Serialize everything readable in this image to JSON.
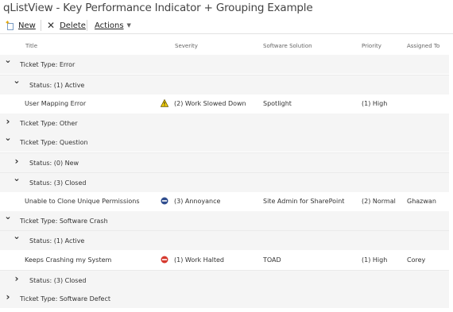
{
  "title": "qListView - Key Performance Indicator + Grouping Example",
  "toolbar": {
    "new_label": "New",
    "delete_label": "Delete",
    "actions_label": "Actions"
  },
  "columns": {
    "title": "Title",
    "severity": "Severity",
    "solution": "Software Solution",
    "priority": "Priority",
    "assigned": "Assigned To"
  },
  "rows": [
    {
      "type": "group1",
      "label": "Ticket Type: Error",
      "expanded": true
    },
    {
      "type": "group2",
      "label": "Status: (1) Active",
      "expanded": true
    },
    {
      "type": "item",
      "title": "User Mapping Error",
      "severity_icon": "warning-icon",
      "severity": "(2) Work Slowed Down",
      "solution": "Spotlight",
      "priority": "(1) High",
      "assigned": ""
    },
    {
      "type": "group1",
      "label": "Ticket Type: Other",
      "expanded": false
    },
    {
      "type": "group1",
      "label": "Ticket Type: Question",
      "expanded": true
    },
    {
      "type": "group2",
      "label": "Status: (0) New",
      "expanded": false
    },
    {
      "type": "group2",
      "label": "Status: (3) Closed",
      "expanded": true
    },
    {
      "type": "item",
      "title": "Unable to Clone Unique Permissions",
      "severity_icon": "annoyance-icon",
      "severity": "(3) Annoyance",
      "solution": "Site Admin for SharePoint",
      "priority": "(2) Normal",
      "assigned": "Ghazwan"
    },
    {
      "type": "group1",
      "label": "Ticket Type: Software Crash",
      "expanded": true
    },
    {
      "type": "group2",
      "label": "Status: (1) Active",
      "expanded": true
    },
    {
      "type": "item",
      "title": "Keeps Crashing my System",
      "severity_icon": "halted-icon",
      "severity": "(1) Work Halted",
      "solution": "TOAD",
      "priority": "(1) High",
      "assigned": "Corey"
    },
    {
      "type": "group2",
      "label": "Status: (3) Closed",
      "expanded": false
    },
    {
      "type": "group1",
      "label": "Ticket Type: Software Defect",
      "expanded": false
    }
  ]
}
